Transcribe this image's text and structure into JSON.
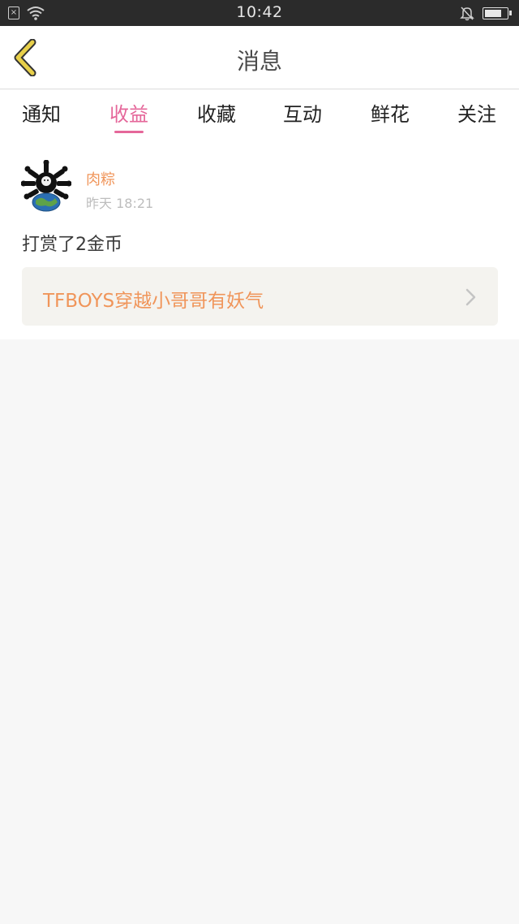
{
  "status_bar": {
    "time": "10:42",
    "sim_glyph": "×",
    "icons": [
      "sim-icon",
      "wifi-icon",
      "mute-icon",
      "battery-icon"
    ]
  },
  "nav": {
    "title": "消息",
    "back_icon": "chevron-left-icon",
    "back_color": "#e8d04a"
  },
  "tabs": [
    {
      "label": "通知",
      "active": false
    },
    {
      "label": "收益",
      "active": true
    },
    {
      "label": "收藏",
      "active": false
    },
    {
      "label": "互动",
      "active": false
    },
    {
      "label": "鲜花",
      "active": false
    },
    {
      "label": "关注",
      "active": false
    }
  ],
  "message": {
    "username": "肉粽",
    "time": "昨天 18:21",
    "content": "打赏了2金币",
    "link_text": "TFBOYS穿越小哥哥有妖气"
  },
  "colors": {
    "accent_pink": "#e5679a",
    "accent_orange": "#f0955a"
  }
}
